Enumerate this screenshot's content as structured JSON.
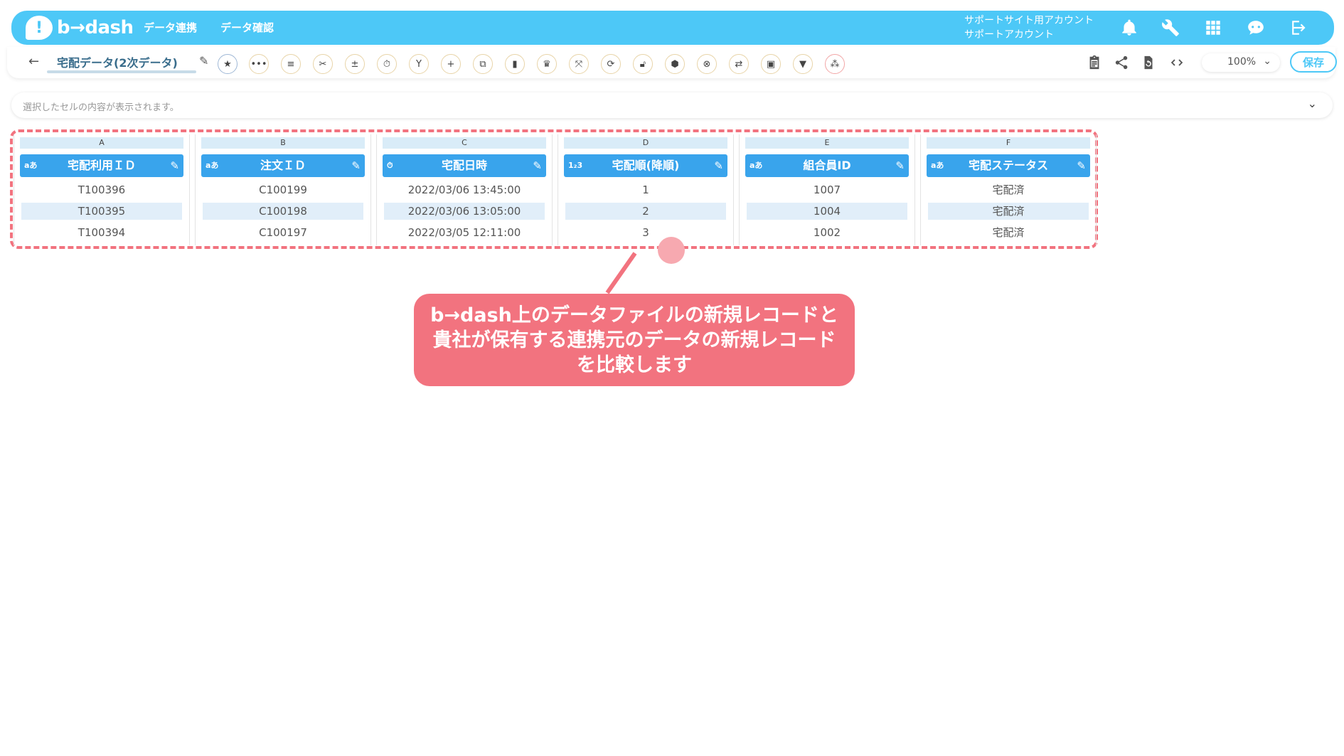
{
  "header": {
    "logo_text": "b→dash",
    "logo_mark": "!",
    "nav": [
      "データ連携",
      "データ確認"
    ],
    "account_line1": "サポートサイト用アカウント",
    "account_line2": "サポートアカウント"
  },
  "toolbar": {
    "back": "←",
    "file_name": "宅配データ(2次データ)",
    "zoom": "100%",
    "save_label": "保存"
  },
  "cellbar": {
    "placeholder": "選択したセルの内容が表示されます。"
  },
  "columns": [
    {
      "letter": "A",
      "type": "aあ",
      "name": "宅配利用ＩＤ",
      "cells": [
        "T100396",
        "T100395",
        "T100394"
      ]
    },
    {
      "letter": "B",
      "type": "aあ",
      "name": "注文ＩＤ",
      "cells": [
        "C100199",
        "C100198",
        "C100197"
      ]
    },
    {
      "letter": "C",
      "type": "⏱",
      "name": "宅配日時",
      "cells": [
        "2022/03/06 13:45:00",
        "2022/03/06 13:05:00",
        "2022/03/05 12:11:00"
      ]
    },
    {
      "letter": "D",
      "type": "1₂3",
      "name": "宅配順(降順)",
      "cells": [
        "1",
        "2",
        "3"
      ]
    },
    {
      "letter": "E",
      "type": "aあ",
      "name": "組合員ID",
      "cells": [
        "1007",
        "1004",
        "1002"
      ]
    },
    {
      "letter": "F",
      "type": "aあ",
      "name": "宅配ステータス",
      "cells": [
        "宅配済",
        "宅配済",
        "宅配済"
      ]
    }
  ],
  "callout": {
    "line1": "b→dash上のデータファイルの新規レコードと",
    "line2": "貴社が保有する連携元のデータの新規レコード",
    "line3": "を比較します"
  },
  "colors": {
    "brand": "#4dc8f7",
    "header_column": "#39a4ec",
    "highlight": "#f2737f"
  }
}
